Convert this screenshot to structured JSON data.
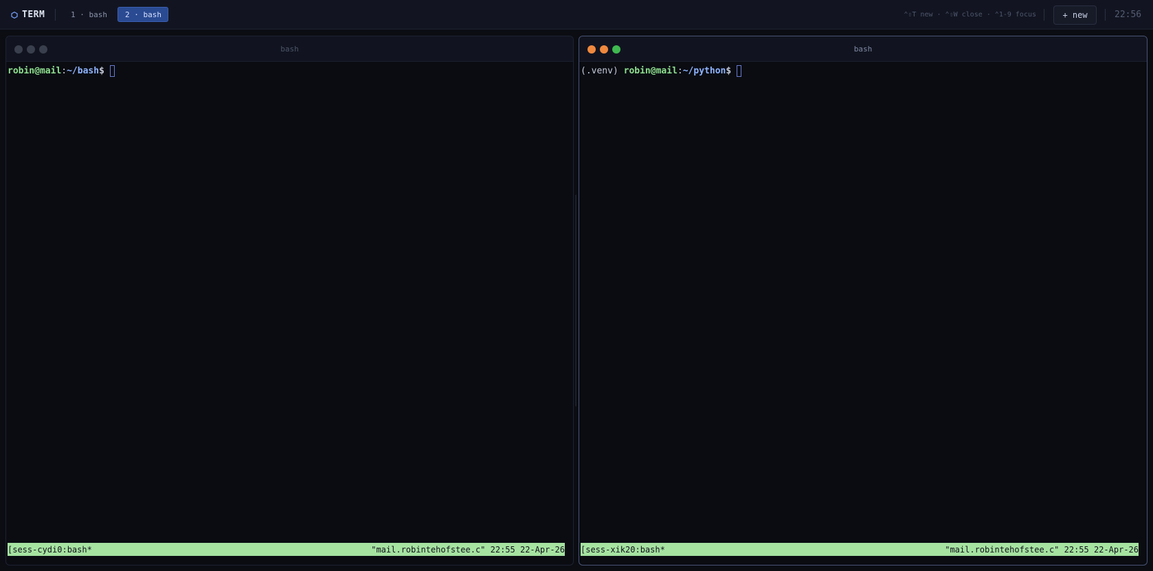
{
  "topbar": {
    "brand": "TERM",
    "tabs": [
      {
        "label": "1 · bash",
        "active": false
      },
      {
        "label": "2 · bash",
        "active": true
      }
    ],
    "shortcuts": "⌃⇧T new · ⌃⇧W close · ⌃1-9 focus",
    "new_button": "+ new",
    "clock": "22:56"
  },
  "panes": [
    {
      "title": "bash",
      "focused": false,
      "prompt": {
        "prefix": "",
        "user": "robin@mail",
        "colon": ":",
        "path": "~/bash",
        "dollar": "$"
      },
      "status": {
        "left": "[sess-cydi0:bash*",
        "right": "\"mail.robintehofstee.c\" 22:55 22-Apr-26"
      },
      "dot_colors": [
        "#3a3f4d",
        "#3a3f4d",
        "#3a3f4d"
      ]
    },
    {
      "title": "bash",
      "focused": true,
      "prompt": {
        "prefix": "(.venv) ",
        "user": "robin@mail",
        "colon": ":",
        "path": "~/python",
        "dollar": "$"
      },
      "status": {
        "left": "[sess-xik20:bash*",
        "right": "\"mail.robintehofstee.c\" 22:55 22-Apr-26"
      },
      "dot_colors": [
        "#f0883e",
        "#f0883e",
        "#3fb950"
      ]
    }
  ],
  "colors": {
    "accent": "#2a4a92",
    "status_bar": "#a6e3a1",
    "prompt_user": "#8fe08f",
    "prompt_path": "#8fb4ff"
  }
}
